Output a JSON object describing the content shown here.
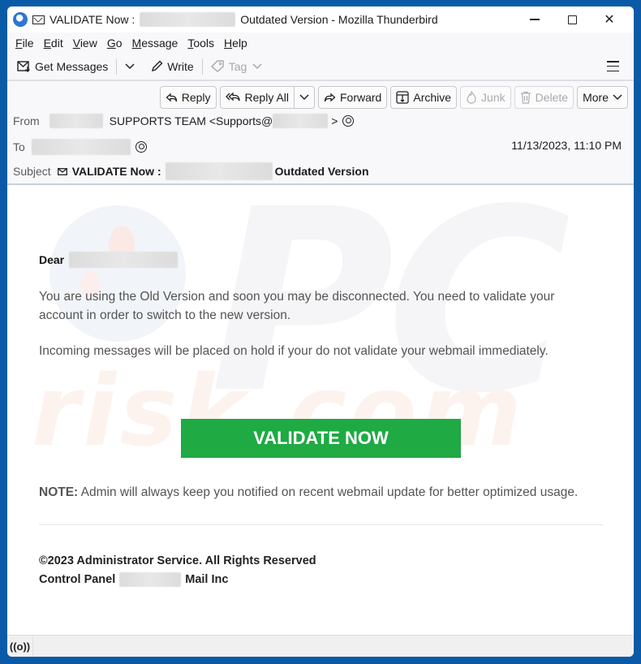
{
  "window": {
    "title_prefix": "VALIDATE Now :",
    "title_suffix": "Outdated Version - Mozilla Thunderbird",
    "controls": {
      "minimize": "minimize",
      "maximize": "maximize",
      "close": "✕"
    }
  },
  "menubar": {
    "items": [
      {
        "accel": "F",
        "rest": "ile"
      },
      {
        "accel": "E",
        "rest": "dit"
      },
      {
        "accel": "V",
        "rest": "iew"
      },
      {
        "accel": "G",
        "rest": "o"
      },
      {
        "accel": "M",
        "rest": "essage"
      },
      {
        "accel": "T",
        "rest": "ools"
      },
      {
        "accel": "H",
        "rest": "elp"
      }
    ]
  },
  "toolbar": {
    "get_messages": "Get Messages",
    "write": "Write",
    "tag": "Tag"
  },
  "actions": {
    "reply": "Reply",
    "reply_all": "Reply All",
    "forward": "Forward",
    "archive": "Archive",
    "junk": "Junk",
    "delete": "Delete",
    "more": "More"
  },
  "header": {
    "from_label": "From",
    "from_name": "SUPPORTS TEAM <Supports@",
    "from_end": ">",
    "to_label": "To",
    "subject_label": "Subject",
    "subject_prefix": "VALIDATE Now :",
    "subject_suffix": "Outdated Version",
    "date": "11/13/2023, 11:10 PM"
  },
  "body": {
    "greeting": "Dear",
    "paragraph1": "You are using the Old Version and soon you may be disconnected. You need to validate your account in order to switch to the new version.",
    "paragraph2": "Incoming messages will be placed on hold if your do not validate your webmail immediately.",
    "cta_label": "VALIDATE NOW",
    "cta_color": "#1faa44",
    "note_label": "NOTE:",
    "note_text": " Admin will always keep you notified on recent webmail update for better optimized usage.",
    "footer_line1": "©2023 Administrator Service. All Rights Reserved",
    "footer_line2_prefix": "Control Panel",
    "footer_line2_suffix": "Mail Inc"
  },
  "watermark": {
    "top": "PC",
    "bottom": "risk.com"
  },
  "statusbar": {
    "icon": "((o))"
  }
}
